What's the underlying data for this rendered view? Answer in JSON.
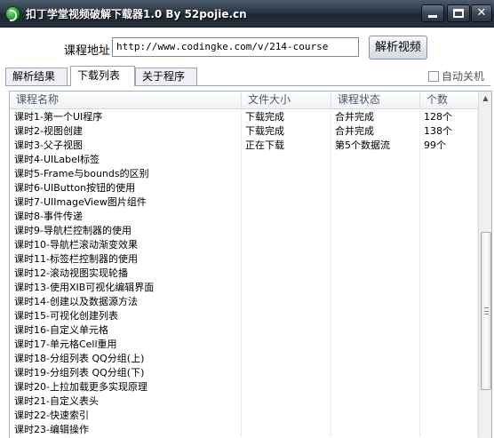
{
  "window": {
    "title": "扣丁学堂视频破解下载器1.0 By 52pojie.cn",
    "icon": "app-logo-icon",
    "controls": [
      "minimize-icon",
      "maximize-icon",
      "close-icon"
    ]
  },
  "url_bar": {
    "label": "课程地址",
    "value": "http://www.codingke.com/v/214-course",
    "button": "解析视频"
  },
  "tabs": [
    {
      "label": "解析结果",
      "active": false
    },
    {
      "label": "下载列表",
      "active": true
    },
    {
      "label": "关于程序",
      "active": false
    }
  ],
  "options": {
    "auto_shutdown_label": "自动关机",
    "auto_shutdown_checked": false
  },
  "table": {
    "columns": [
      "课程名称",
      "文件大小",
      "课程状态",
      "个数"
    ],
    "rows": [
      {
        "name": "课时1-第一个UI程序",
        "size": "下载完成",
        "status": "合并完成",
        "count": "128个"
      },
      {
        "name": "课时2-视图创建",
        "size": "下载完成",
        "status": "合并完成",
        "count": "138个"
      },
      {
        "name": "课时3-父子视图",
        "size": "正在下载",
        "status": "第5个数据流",
        "count": "99个"
      },
      {
        "name": "课时4-UILabel标签",
        "size": "",
        "status": "",
        "count": ""
      },
      {
        "name": "课时5-Frame与bounds的区别",
        "size": "",
        "status": "",
        "count": ""
      },
      {
        "name": "课时6-UIButton按钮的使用",
        "size": "",
        "status": "",
        "count": ""
      },
      {
        "name": "课时7-UIImageView图片组件",
        "size": "",
        "status": "",
        "count": ""
      },
      {
        "name": "课时8-事件传递",
        "size": "",
        "status": "",
        "count": ""
      },
      {
        "name": "课时9-导航栏控制器的使用",
        "size": "",
        "status": "",
        "count": ""
      },
      {
        "name": "课时10-导航栏滚动渐变效果",
        "size": "",
        "status": "",
        "count": ""
      },
      {
        "name": "课时11-标签栏控制器的使用",
        "size": "",
        "status": "",
        "count": ""
      },
      {
        "name": "课时12-滚动视图实现轮播",
        "size": "",
        "status": "",
        "count": ""
      },
      {
        "name": "课时13-使用XIB可视化编辑界面",
        "size": "",
        "status": "",
        "count": ""
      },
      {
        "name": "课时14-创建以及数据源方法",
        "size": "",
        "status": "",
        "count": ""
      },
      {
        "name": "课时15-可视化创建列表",
        "size": "",
        "status": "",
        "count": ""
      },
      {
        "name": "课时16-自定义单元格",
        "size": "",
        "status": "",
        "count": ""
      },
      {
        "name": "课时17-单元格Cell重用",
        "size": "",
        "status": "",
        "count": ""
      },
      {
        "name": "课时18-分组列表 QQ分组(上)",
        "size": "",
        "status": "",
        "count": ""
      },
      {
        "name": "课时19-分组列表 QQ分组(下)",
        "size": "",
        "status": "",
        "count": ""
      },
      {
        "name": "课时20-上拉加载更多实现原理",
        "size": "",
        "status": "",
        "count": ""
      },
      {
        "name": "课时21-自定义表头",
        "size": "",
        "status": "",
        "count": ""
      },
      {
        "name": "课时22-快速索引",
        "size": "",
        "status": "",
        "count": ""
      },
      {
        "name": "课时23-编辑操作",
        "size": "",
        "status": "",
        "count": ""
      }
    ]
  }
}
